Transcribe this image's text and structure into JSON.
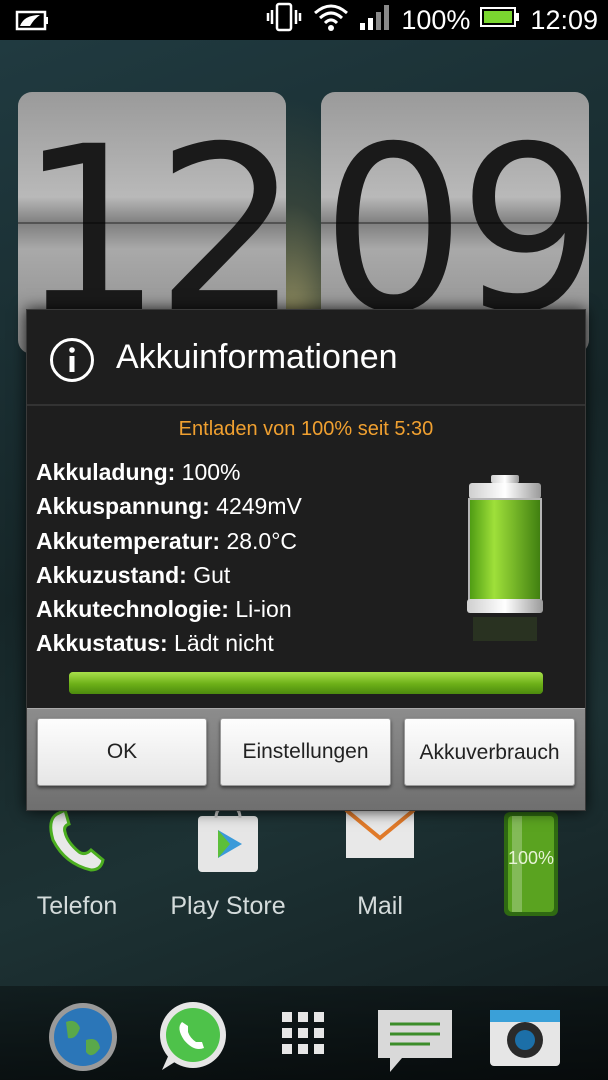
{
  "status_bar": {
    "notification_icon": "battery-info-notification-icon",
    "battery_percent": "100%",
    "time": "12:09"
  },
  "clock_widget": {
    "hours": "12",
    "minutes": "09"
  },
  "home_apps": [
    {
      "label": "Telefon",
      "icon": "phone-icon"
    },
    {
      "label": "Play Store",
      "icon": "play-store-icon"
    },
    {
      "label": "Mail",
      "icon": "mail-icon"
    },
    {
      "label": "",
      "icon": "battery-widget-icon",
      "badge": "100%"
    }
  ],
  "dock": [
    "globe-icon",
    "whatsapp-icon",
    "app-drawer-icon",
    "messages-icon",
    "camera-icon"
  ],
  "dialog": {
    "title": "Akkuinformationen",
    "subtitle": "Entladen von 100% seit 5:30",
    "rows": [
      {
        "key": "Akkuladung:",
        "value": "100%"
      },
      {
        "key": "Akkuspannung:",
        "value": "4249mV"
      },
      {
        "key": "Akkutemperatur:",
        "value": "28.0°C"
      },
      {
        "key": "Akkuzustand:",
        "value": "Gut"
      },
      {
        "key": "Akkutechnologie:",
        "value": "Li-ion"
      },
      {
        "key": "Akkustatus:",
        "value": "Lädt nicht"
      }
    ],
    "charge_level": 1.0,
    "buttons": {
      "ok": "OK",
      "settings": "Einstellungen",
      "usage": "Akkuverbrauch"
    }
  },
  "colors": {
    "accent_orange": "#f0a030",
    "battery_green": "#6cb018"
  }
}
